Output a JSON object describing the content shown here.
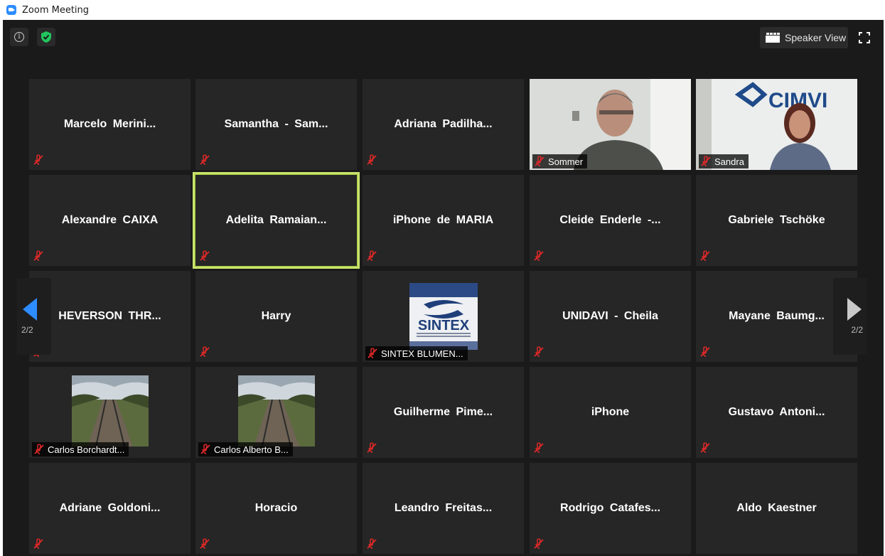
{
  "window": {
    "title": "Zoom Meeting"
  },
  "toolbar": {
    "speaker_view_label": "Speaker View"
  },
  "pagination": {
    "left_label": "2/2",
    "right_label": "2/2"
  },
  "colors": {
    "background": "#1a1a1a",
    "tile": "#262626",
    "active_border": "#c8e36b",
    "mute_red": "#e02828",
    "zoom_blue": "#2d8cff",
    "shield_green": "#22c55e"
  },
  "participants": [
    {
      "name": "Marcelo  Merini..."
    },
    {
      "name": "Samantha  -  Sam..."
    },
    {
      "name": "Adriana  Padilha..."
    },
    {
      "name": "Sommer",
      "video": true
    },
    {
      "name": "Sandra",
      "video": true
    },
    {
      "name": "Alexandre CAIXA"
    },
    {
      "name": "Adelita  Ramaian...",
      "active": true
    },
    {
      "name": "iPhone de MARIA"
    },
    {
      "name": "Cleide  Enderle  -..."
    },
    {
      "name": "Gabriele Tschöke"
    },
    {
      "name": "HEVERSON  THR..."
    },
    {
      "name": "Harry"
    },
    {
      "name": "SINTEX BLUMEN...",
      "picture": "logo"
    },
    {
      "name": "UNIDAVI - Cheila"
    },
    {
      "name": "Mayane  Baumg..."
    },
    {
      "name": "Carlos Borchardt...",
      "picture": "railway"
    },
    {
      "name": "Carlos Alberto B...",
      "picture": "railway"
    },
    {
      "name": "Guilherme  Pime..."
    },
    {
      "name": "iPhone"
    },
    {
      "name": "Gustavo  Antoni..."
    },
    {
      "name": "Adriane  Goldoni..."
    },
    {
      "name": "Horacio"
    },
    {
      "name": "Leandro  Freitas..."
    },
    {
      "name": "Rodrigo  Catafes..."
    },
    {
      "name": "Aldo Kaestner"
    }
  ],
  "sintex_logo": {
    "text": "SINTEX"
  },
  "video_backdrop": {
    "brand_text": "CIMVI"
  }
}
